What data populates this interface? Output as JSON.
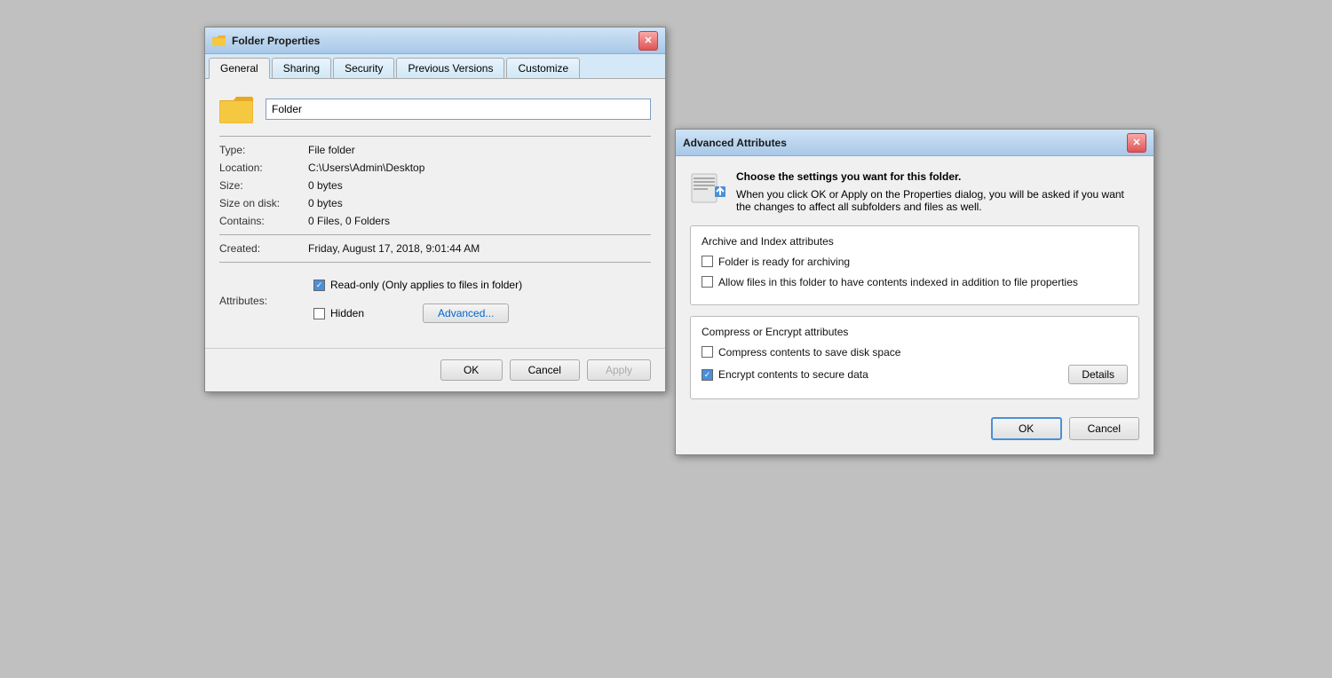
{
  "folderProps": {
    "title": "Folder Properties",
    "tabs": [
      {
        "id": "general",
        "label": "General",
        "active": true
      },
      {
        "id": "sharing",
        "label": "Sharing",
        "active": false
      },
      {
        "id": "security",
        "label": "Security",
        "active": false
      },
      {
        "id": "previous-versions",
        "label": "Previous Versions",
        "active": false
      },
      {
        "id": "customize",
        "label": "Customize",
        "active": false
      }
    ],
    "folderName": "Folder",
    "info": {
      "type_label": "Type:",
      "type_value": "File folder",
      "location_label": "Location:",
      "location_value": "C:\\Users\\Admin\\Desktop",
      "size_label": "Size:",
      "size_value": "0 bytes",
      "size_on_disk_label": "Size on disk:",
      "size_on_disk_value": "0 bytes",
      "contains_label": "Contains:",
      "contains_value": "0 Files, 0 Folders",
      "created_label": "Created:",
      "created_value": "Friday, August 17, 2018, 9:01:44 AM"
    },
    "attributes": {
      "label": "Attributes:",
      "readonly_label": "Read-only (Only applies to files in folder)",
      "readonly_checked": true,
      "hidden_label": "Hidden",
      "hidden_checked": false,
      "advanced_label": "Advanced..."
    },
    "buttons": {
      "ok": "OK",
      "cancel": "Cancel",
      "apply": "Apply"
    }
  },
  "advancedAttrs": {
    "title": "Advanced Attributes",
    "header_line1": "Choose the settings you want for this folder.",
    "header_line2": "When you click OK or Apply on the Properties dialog, you will be asked if you want the changes to affect all subfolders and files as well.",
    "archive_section_title": "Archive and Index attributes",
    "archive_checkbox_label": "Folder is ready for archiving",
    "archive_checked": false,
    "index_checkbox_label": "Allow files in this folder to have contents indexed in addition to file properties",
    "index_checked": false,
    "compress_section_title": "Compress or Encrypt attributes",
    "compress_checkbox_label": "Compress contents to save disk space",
    "compress_checked": false,
    "encrypt_checkbox_label": "Encrypt contents to secure data",
    "encrypt_checked": true,
    "details_label": "Details",
    "ok_label": "OK",
    "cancel_label": "Cancel"
  }
}
